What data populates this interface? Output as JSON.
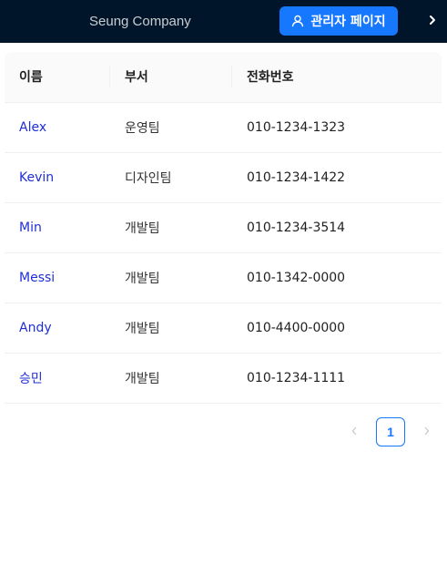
{
  "header": {
    "brand": "Seung Company",
    "admin_button_label": "관리자 페이지",
    "accent": "#1677ff",
    "background": "#001529"
  },
  "table": {
    "columns": [
      "이름",
      "부서",
      "전화번호"
    ],
    "rows": [
      {
        "name": "Alex",
        "dept": "운영팀",
        "phone": "010-1234-1323"
      },
      {
        "name": "Kevin",
        "dept": "디자인팀",
        "phone": "010-1234-1422"
      },
      {
        "name": "Min",
        "dept": "개발팀",
        "phone": "010-1234-3514"
      },
      {
        "name": "Messi",
        "dept": "개발팀",
        "phone": "010-1342-0000"
      },
      {
        "name": "Andy",
        "dept": "개발팀",
        "phone": "010-4400-0000"
      },
      {
        "name": "승민",
        "dept": "개발팀",
        "phone": "010-1234-1111"
      }
    ]
  },
  "pagination": {
    "current_page": "1"
  }
}
